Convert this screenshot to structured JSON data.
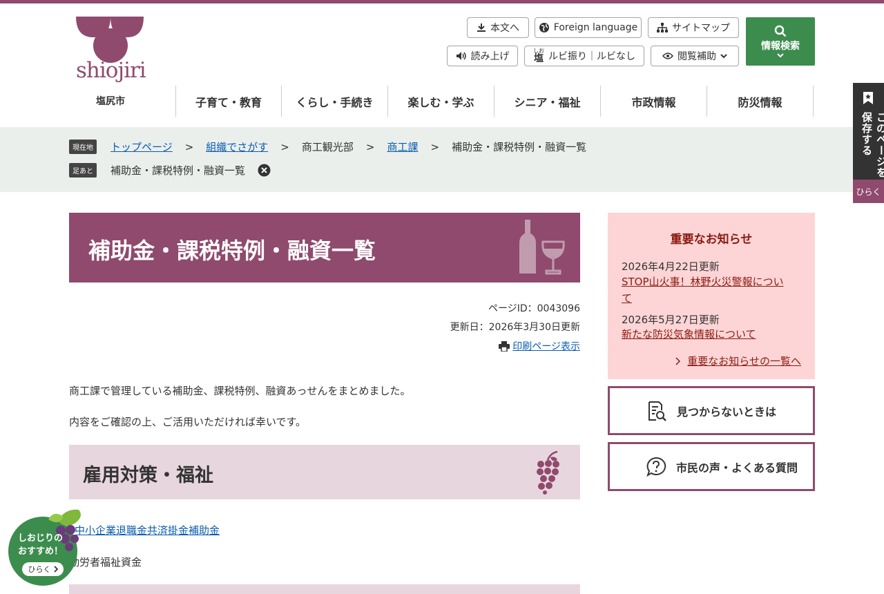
{
  "colors": {
    "brand": "#8f4a6e",
    "green": "#3c8c4e",
    "notice_bg": "#fdd5d6",
    "notice_text": "#8b1a10",
    "crumb_bg": "#ebefec"
  },
  "header": {
    "logo_wordmark": "shiojiri",
    "city_name": "塩尻市",
    "utility": {
      "main_text": "本文へ",
      "foreign": "Foreign language",
      "sitemap": "サイトマップ",
      "read_aloud": "読み上げ",
      "ruby_top": "しお",
      "ruby_base": "塩",
      "ruby": "ルビ振り｜ルビなし",
      "browse_assist": "閲覧補助"
    },
    "search_label": "情報検索"
  },
  "nav": [
    "子育て・教育",
    "くらし・手続き",
    "楽しむ・学ぶ",
    "シニア・福祉",
    "市政情報",
    "防災情報"
  ],
  "breadcrumb": {
    "current_tag": "現在地",
    "items": [
      {
        "label": "トップページ",
        "link": true
      },
      {
        "label": "組織でさがす",
        "link": true
      },
      {
        "label": "商工観光部",
        "link": false
      },
      {
        "label": "商工課",
        "link": true
      },
      {
        "label": "補助金・課税特例・融資一覧",
        "link": false
      }
    ],
    "footprint_tag": "足あと",
    "footprint_item": "補助金・課税特例・融資一覧"
  },
  "side_tab": {
    "text": "このページを一時保存する",
    "open": "ひらく"
  },
  "page": {
    "title": "補助金・課税特例・融資一覧",
    "page_id": "ページID：0043096",
    "updated": "更新日：2026年3月30日更新",
    "print": "印刷ページ表示",
    "intro1": "商工課で管理している補助金、課税特例、融資あっせんをまとめました。",
    "intro2": "内容をご確認の上、ご活用いただければ幸いです。",
    "section1": "雇用対策・福祉",
    "link1": "中小企業退職金共済掛金補助金",
    "text1": "勤労者福祉資金"
  },
  "notice": {
    "title": "重要なお知らせ",
    "items": [
      {
        "date": "2026年4月22日更新",
        "text1": "STOP山火事！林野火災警報につい",
        "text2": "て"
      },
      {
        "date": "2026年5月27日更新",
        "text1": "新たな防災気象情報について"
      }
    ],
    "more": "重要なお知らせの一覧へ"
  },
  "sidebox": {
    "not_found": "見つからないときは",
    "faq": "市民の声・よくある質問"
  },
  "badge": {
    "line1": "しおじりの",
    "line2": "おすすめ！",
    "open": "ひらく"
  }
}
